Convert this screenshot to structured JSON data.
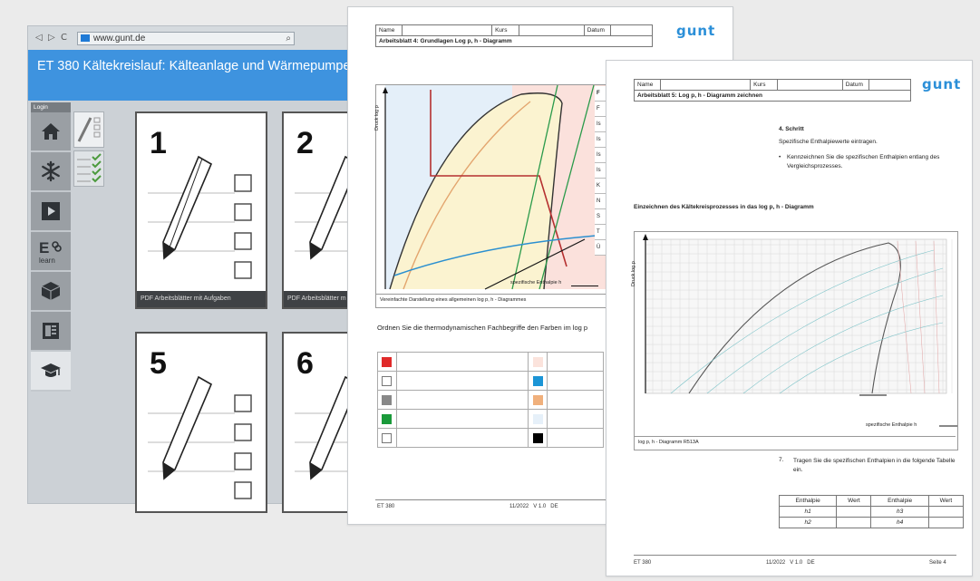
{
  "browser": {
    "nav_back": "◁",
    "nav_forward": "▷",
    "nav_reload": "C",
    "url": "www.gunt.de",
    "search_glyph": "⌕",
    "app_title": "ET 380 Kältekreislauf: Kälteanlage und Wärmepumpe",
    "login_label": "Login",
    "sidebar_icons": [
      "home-icon",
      "snowflake-icon",
      "play-icon",
      "e-learn-icon",
      "cube-icon",
      "book-icon",
      "graduation-cap-icon"
    ],
    "cards": [
      {
        "number": "1",
        "footer": "PDF Arbeitsblätter mit Aufgaben"
      },
      {
        "number": "2",
        "footer": "PDF Arbeitsblätter m"
      },
      {
        "number": "5",
        "footer": ""
      },
      {
        "number": "6",
        "footer": ""
      }
    ]
  },
  "sheet4": {
    "labels": {
      "name": "Name",
      "kurs": "Kurs",
      "datum": "Datum"
    },
    "title": "Arbeitsblatt 4: Grundlagen Log p, h - Diagramm",
    "logo": "gunt",
    "y_axis": "Druck log p",
    "x_axis": "spezifische Enthalpie h",
    "caption": "Vereinfachte Darstellung eines allgemeinen log p, h - Diagrammes",
    "legend_letters": [
      "F",
      "F",
      "Is",
      "Is",
      "Is",
      "Is",
      "K",
      "N",
      "S",
      "T",
      "Ü"
    ],
    "instruction": "Ordnen Sie die thermodynamischen Fachbegriffe den Farben im log p",
    "swatches_left": [
      "#e02a2a",
      "#ffffff",
      "#888888",
      "#1a9a3a",
      "#ffffff"
    ],
    "swatches_right": [
      "#fbe3dc",
      "#1c95d6",
      "#f0b07c",
      "#e6f0f9",
      "#000000"
    ],
    "footer_left": "ET 380",
    "footer_mid": "11/2022   V 1.0   DE"
  },
  "sheet5": {
    "labels": {
      "name": "Name",
      "kurs": "Kurs",
      "datum": "Datum"
    },
    "title": "Arbeitsblatt 5: Log p, h - Diagramm zeichnen",
    "logo": "gunt",
    "step": "4. Schritt",
    "step_text": "Spezifische Enthalpiewerte eintragen.",
    "bullet_text": "Kennzeichnen Sie die spezifischen Enthalpien entlang des Vergleichsprozesses.",
    "section": "Einzeichnen des Kältekreisprozesses in das log p, h - Diagramm",
    "y_axis": "Druck log p",
    "x_axis": "spezifische Enthalpie h",
    "caption": "log p, h - Diagramm R513A",
    "task_num": "7.",
    "task_text": "Tragen Sie die spezifischen Enthalpien in die folgende Tabelle ein.",
    "table": {
      "headers": [
        "Enthalpie",
        "Wert",
        "Enthalpie",
        "Wert"
      ],
      "rows": [
        [
          "h1",
          "",
          "h3",
          ""
        ],
        [
          "h2",
          "",
          "h4",
          ""
        ]
      ]
    },
    "footer_left": "ET 380",
    "footer_mid": "11/2022   V 1.0   DE",
    "footer_right": "Seite 4"
  }
}
